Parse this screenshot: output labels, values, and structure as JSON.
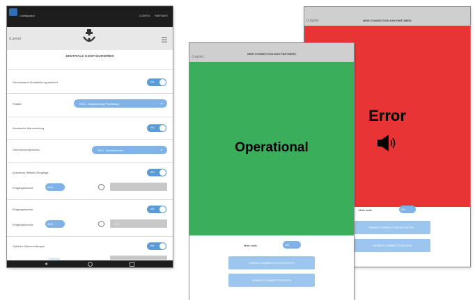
{
  "left_screen": {
    "status_bar": {
      "app_name": "Configurator",
      "right_a": "CONFIG",
      "right_b": "PARTNER"
    },
    "header": {
      "back_label": "Layout",
      "logo": "anchor-tower-logo-icon",
      "menu_icon": "menu-icon"
    },
    "title": "ZENTRALE KONFIGURIEREN",
    "rows": [
      {
        "label": "Gemeinsame Abhaltelösung aktiviert",
        "toggle": "on"
      },
      {
        "label": "Projekt",
        "select": "SEIZ - Hauptleitung (Fluchtweg)"
      },
      {
        "label": "Akustische Warnmeldung",
        "toggle": "on"
      },
      {
        "label": "Überwachungsmodus",
        "select": "SEIZ - Normalmodus"
      },
      {
        "label": "Anschluss Hilfsfeld Eingänge",
        "toggle": "on",
        "sub_label": "Eingangsbuchse",
        "pill": "AUS"
      },
      {
        "label": "Eingangsbuchse",
        "toggle": "on",
        "sub_label": "Eingangsbuchse",
        "pill": "AUS",
        "grey_text": "GED"
      },
      {
        "label": "Optische Warnmeldungen",
        "toggle": "on",
        "sub_label": "Leistung"
      }
    ],
    "toggle_label": "AN"
  },
  "green_screen": {
    "header": {
      "back_label": "Layout",
      "title": "NEW CONNECTION KNX PARTNERS"
    },
    "status": "Operational",
    "status_color": "#3aae5b",
    "mute_label": "Mute radio",
    "mute_toggle": "ON",
    "buttons": [
      "PAIRED CONNECTION DETECTED",
      "CHANGE CONNECTION DATA"
    ]
  },
  "red_screen": {
    "header": {
      "back_label": "Layout",
      "title": "NEW CONNECTION KNX PARTNERS"
    },
    "status": "Error",
    "status_color": "#e83434",
    "alarm_icon": "speaker-sound-icon",
    "mute_label": "Mute radio",
    "mute_toggle": "ON",
    "buttons": [
      "PAIRED CONNECTION DETECTED",
      "CHANGE CONNECTION DATA"
    ]
  }
}
